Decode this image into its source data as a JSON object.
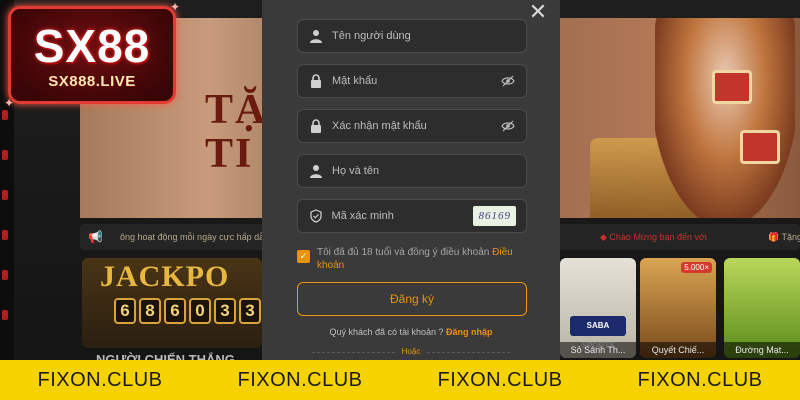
{
  "logo": {
    "main": "SX88",
    "sub": "SX888.LIVE"
  },
  "banner": {
    "line1": "TẶNG",
    "line2": "TI"
  },
  "ticker": {
    "left_text": "ông hoạt động mỗi ngày cực hấp dẫ",
    "right_text": "Chào Mừng bạn đến với",
    "right_text_2": "Tặng"
  },
  "jackpot": {
    "label": "JACKPO",
    "digits": [
      "6",
      "8",
      "6",
      "0",
      "3",
      "3"
    ]
  },
  "section": {
    "title": "NGƯỜI CHIẾN THẮNG"
  },
  "games": [
    {
      "caption": "Sỏ Sảnh Th...",
      "logo": "SABA SPORTS",
      "color": "#d7d2c8"
    },
    {
      "caption": "Quyết Chiế...",
      "badge": "5.000×",
      "color": "#c28a3a"
    },
    {
      "caption": "Đường Mạt...",
      "color": "#8bbd3a"
    }
  ],
  "form": {
    "username_placeholder": "Tên người dùng",
    "password_placeholder": "Mật khẩu",
    "confirm_placeholder": "Xác nhận mật khẩu",
    "fullname_placeholder": "Họ và tên",
    "captcha_placeholder": "Mã xác minh",
    "captcha_code": "86169",
    "agree_text": "Tôi đã đủ 18 tuổi và đồng ý điều khoản ",
    "agree_link": "Điều khoản",
    "register_label": "Đăng ký",
    "has_account": "Quý khách đã có tài khoản ? ",
    "login_link": "Đăng nhập",
    "or_text": "Hoặc",
    "accent_color": "#e8930b"
  },
  "footer": {
    "labels": [
      "FIXON.CLUB",
      "FIXON.CLUB",
      "FIXON.CLUB",
      "FIXON.CLUB"
    ]
  }
}
